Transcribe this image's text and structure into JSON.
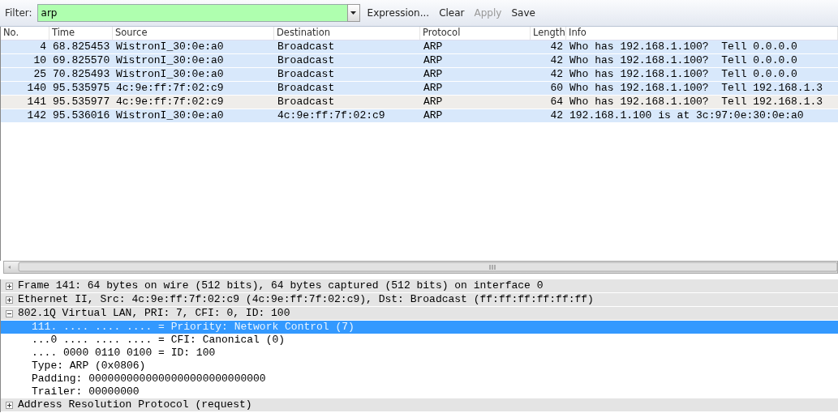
{
  "filter_bar": {
    "label": "Filter:",
    "value": "arp",
    "buttons": [
      {
        "label": "Expression...",
        "disabled": false
      },
      {
        "label": "Clear",
        "disabled": false
      },
      {
        "label": "Apply",
        "disabled": true
      },
      {
        "label": "Save",
        "disabled": false
      }
    ]
  },
  "packet_list": {
    "columns": [
      "No.",
      "Time",
      "Source",
      "Destination",
      "Protocol",
      "Length",
      "Info"
    ],
    "rows": [
      {
        "cells": [
          "4",
          "68.825453",
          "WistronI_30:0e:a0",
          "Broadcast",
          "ARP",
          "42",
          "Who has 192.168.1.100?  Tell 0.0.0.0"
        ],
        "selected": false
      },
      {
        "cells": [
          "10",
          "69.825570",
          "WistronI_30:0e:a0",
          "Broadcast",
          "ARP",
          "42",
          "Who has 192.168.1.100?  Tell 0.0.0.0"
        ],
        "selected": false
      },
      {
        "cells": [
          "25",
          "70.825493",
          "WistronI_30:0e:a0",
          "Broadcast",
          "ARP",
          "42",
          "Who has 192.168.1.100?  Tell 0.0.0.0"
        ],
        "selected": false
      },
      {
        "cells": [
          "140",
          "95.535975",
          "4c:9e:ff:7f:02:c9",
          "Broadcast",
          "ARP",
          "60",
          "Who has 192.168.1.100?  Tell 192.168.1.3"
        ],
        "selected": false
      },
      {
        "cells": [
          "141",
          "95.535977",
          "4c:9e:ff:7f:02:c9",
          "Broadcast",
          "ARP",
          "64",
          "Who has 192.168.1.100?  Tell 192.168.1.3"
        ],
        "selected": true
      },
      {
        "cells": [
          "142",
          "95.536016",
          "WistronI_30:0e:a0",
          "4c:9e:ff:7f:02:c9",
          "ARP",
          "42",
          "192.168.1.100 is at 3c:97:0e:30:0e:a0"
        ],
        "selected": false
      }
    ]
  },
  "packet_details": [
    {
      "label": "Frame 141: 64 bytes on wire (512 bits), 64 bytes captured (512 bits) on interface 0",
      "expanded": false
    },
    {
      "label": "Ethernet II, Src: 4c:9e:ff:7f:02:c9 (4c:9e:ff:7f:02:c9), Dst: Broadcast (ff:ff:ff:ff:ff:ff)",
      "expanded": false
    },
    {
      "label": "802.1Q Virtual LAN, PRI: 7, CFI: 0, ID: 100",
      "expanded": true,
      "children": [
        {
          "label": "111. .... .... .... = Priority: Network Control (7)",
          "selected": true
        },
        {
          "label": "...0 .... .... .... = CFI: Canonical (0)",
          "selected": false
        },
        {
          "label": ".... 0000 0110 0100 = ID: 100",
          "selected": false
        },
        {
          "label": "Type: ARP (0x0806)",
          "selected": false
        },
        {
          "label": "Padding: 0000000000000000000000000000",
          "selected": false
        },
        {
          "label": "Trailer: 00000000",
          "selected": false
        }
      ]
    },
    {
      "label": "Address Resolution Protocol (request)",
      "expanded": false
    }
  ]
}
